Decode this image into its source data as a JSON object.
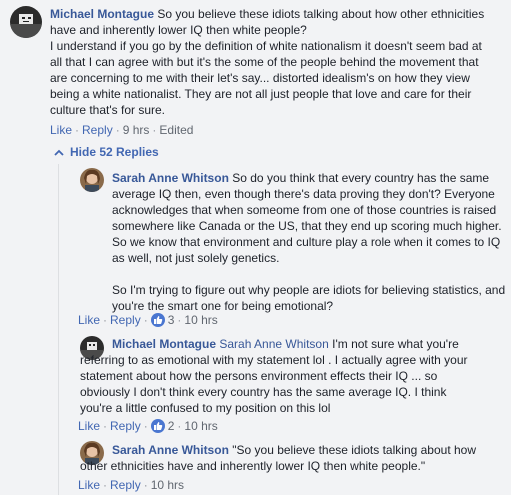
{
  "comments": [
    {
      "author": "Michael Montague",
      "text_lines": [
        "So you believe these idiots talking about how other ethnicities",
        "have and inherently lower IQ then white people?",
        "I understand if you go by the definition of white nationalism it doesn't seem bad at",
        "all that I can agree with but it's the some of the people behind the movement that",
        "are concerning to me with their let's say... distorted idealism's on how they view",
        "being a white nationalist. They are not all just people that love and care for their",
        "culture that's for sure."
      ],
      "actions": {
        "like": "Like",
        "reply": "Reply",
        "time": "9 hrs",
        "edited": "Edited"
      }
    },
    {
      "author": "Sarah Anne Whitson",
      "text_lines": [
        "So do you think that every country has the same",
        "average IQ then, even though there's data proving they don't? Everyone",
        "acknowledges that when someome from one of those countries is raised",
        "somewhere like Canada or the US, that they end up scoring much higher.",
        "So we know that environment and culture play a role when it comes to IQ",
        "as well, not just solely genetics."
      ],
      "text_lines2": [
        "So I'm trying to figure out why people are idiots for believing statistics, and",
        "you're the smart one for being emotional?"
      ],
      "actions": {
        "like": "Like",
        "reply": "Reply",
        "likes": "3",
        "time": "10 hrs"
      }
    },
    {
      "author": "Michael Montague",
      "mention": "Sarah Anne Whitson",
      "text_lines": [
        "I'm not sure what you're",
        "referring to as emotional with my statement lol . I actually agree with your",
        "statement about how the persons environment effects their IQ ... so",
        "obviously I don't think every country has the same average IQ. I think",
        "you're a little confused to my position on this lol"
      ],
      "actions": {
        "like": "Like",
        "reply": "Reply",
        "likes": "2",
        "time": "10 hrs"
      }
    },
    {
      "author": "Sarah Anne Whitson",
      "text_lines": [
        "\"So you believe these idiots talking about how",
        "other ethnicities have and inherently lower IQ then white people.\""
      ],
      "actions": {
        "like": "Like",
        "reply": "Reply",
        "time": "10 hrs"
      }
    }
  ],
  "hide_replies": "Hide 52 Replies",
  "colors": {
    "link": "#385898",
    "action": "#4267b2",
    "meta": "#616770",
    "like_badge": "#4a76d0"
  }
}
